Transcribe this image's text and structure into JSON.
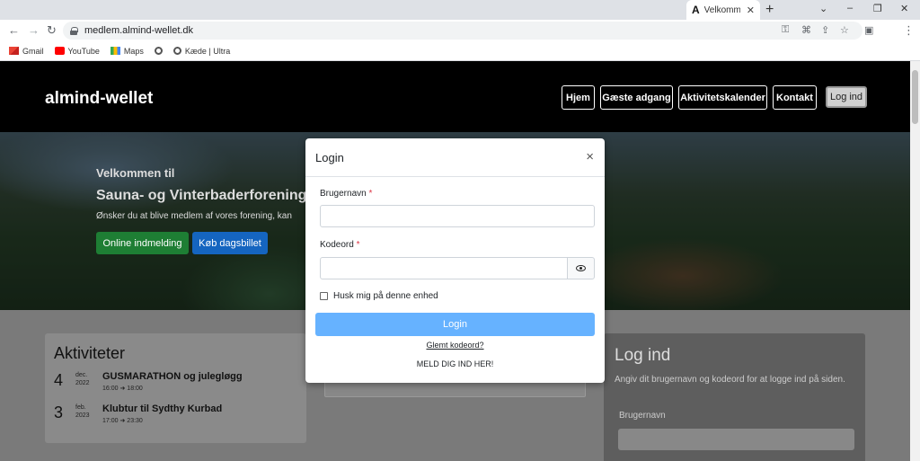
{
  "browser": {
    "tab": {
      "favicon": "A",
      "title": "Velkommen",
      "close": "✕"
    },
    "new_tab": "+",
    "window_controls": {
      "chevron": "⌄",
      "minimize": "–",
      "restore": "❐",
      "close": "✕"
    },
    "nav": {
      "back": "←",
      "forward": "→",
      "reload": "↻"
    },
    "url": "medlem.almind-wellet.dk",
    "omnibox_icons": {
      "key": "⚿",
      "translate": "⌘",
      "share": "⇪",
      "star": "☆"
    },
    "extension_icon": "▣",
    "menu_icon": "⋮",
    "bookmarks": [
      {
        "label": "Gmail",
        "icon": "gmail-icon"
      },
      {
        "label": "YouTube",
        "icon": "youtube-icon"
      },
      {
        "label": "Maps",
        "icon": "maps-icon"
      },
      {
        "label": "",
        "icon": "globe-icon"
      },
      {
        "label": "Kæde | Ultra",
        "icon": "globe-icon"
      }
    ]
  },
  "site": {
    "brand": "almind-wellet",
    "nav": [
      "Hjem",
      "Gæste adgang",
      "Aktivitetskalender",
      "Kontakt",
      "Log ind"
    ],
    "hero": {
      "welcome": "Velkommen til",
      "title": "Sauna- og Vinterbaderforening",
      "subtitle": "Ønsker du at blive medlem af vores forening, kan",
      "btn_online": "Online indmelding",
      "btn_ticket": "Køb dagsbillet"
    },
    "activities": {
      "title": "Aktiviteter",
      "items": [
        {
          "day": "4",
          "month": "dec.",
          "year": "2022",
          "name": "GUSMARATHON og julegløgg",
          "start": "16:00",
          "end": "18:00"
        },
        {
          "day": "3",
          "month": "feb.",
          "year": "2023",
          "name": "Klubtur til Sydthy Kurbad",
          "start": "17:00",
          "end": "23:30"
        }
      ]
    },
    "login_panel": {
      "title": "Log ind",
      "description": "Angiv dit brugernavn og kodeord for at logge ind på siden.",
      "username_label": "Brugernavn"
    }
  },
  "modal": {
    "title": "Login",
    "close": "×",
    "username_label": "Brugernavn",
    "password_label": "Kodeord",
    "required_mark": "*",
    "remember": "Husk mig på denne enhed",
    "login_button": "Login",
    "forgot": "Glemt kodeord?",
    "signup": "MELD DIG IND HER!"
  }
}
